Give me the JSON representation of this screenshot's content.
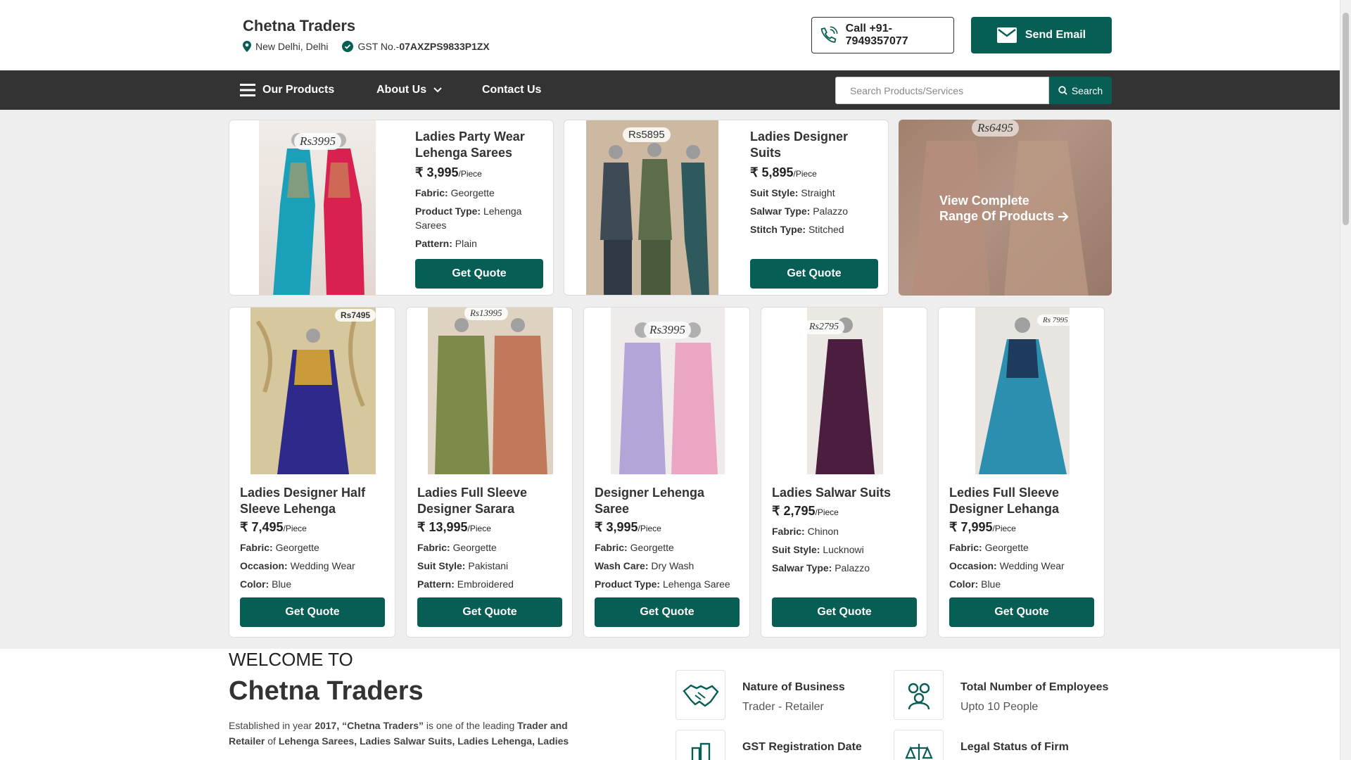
{
  "header": {
    "company_name": "Chetna Traders",
    "location": "New Delhi, Delhi",
    "gst_label": "GST No.-",
    "gst_number": "07AXZPS9833P1ZX",
    "call_label": "Call +91-7949357077",
    "email_label": "Send Email"
  },
  "nav": {
    "products": "Our Products",
    "about": "About Us",
    "contact": "Contact Us",
    "search_placeholder": "Search Products/Services",
    "search_button": "Search"
  },
  "featured": [
    {
      "name_line1": "Ladies Party Wear",
      "name_line2": "Lehenga Sarees",
      "price": "₹ 3,995",
      "unit": "/Piece",
      "tag": "Rs3995",
      "specs": [
        {
          "label": "Fabric:",
          "value": "Georgette"
        },
        {
          "label": "Product Type:",
          "value": "Lehenga"
        },
        {
          "label": "",
          "value": "Sarees"
        },
        {
          "label": "Pattern:",
          "value": "Plain"
        }
      ],
      "cta": "Get Quote"
    },
    {
      "name_line1": "Ladies Designer",
      "name_line2": "Suits",
      "price": "₹ 5,895",
      "unit": "/Piece",
      "tag": "Rs5895",
      "specs": [
        {
          "label": "Suit Style:",
          "value": "Straight"
        },
        {
          "label": "Salwar Type:",
          "value": "Palazzo"
        },
        {
          "label": "Stitch Type:",
          "value": "Stitched"
        }
      ],
      "cta": "Get Quote"
    }
  ],
  "view_all": {
    "line1": "View Complete",
    "line2": "Range Of Products",
    "tag": "Rs6495"
  },
  "products": [
    {
      "name_line1": "Ladies Designer Half",
      "name_line2": "Sleeve Lehenga",
      "price": "₹ 7,495",
      "unit": "/Piece",
      "tag": "Rs7495",
      "specs": [
        {
          "label": "Fabric:",
          "value": "Georgette"
        },
        {
          "label": "Occasion:",
          "value": "Wedding Wear"
        },
        {
          "label": "Color:",
          "value": "Blue"
        }
      ],
      "cta": "Get Quote"
    },
    {
      "name_line1": "Ladies Full Sleeve",
      "name_line2": "Designer Sarara",
      "price": "₹ 13,995",
      "unit": "/Piece",
      "tag": "Rs13995",
      "specs": [
        {
          "label": "Fabric:",
          "value": "Georgette"
        },
        {
          "label": "Suit Style:",
          "value": "Pakistani"
        },
        {
          "label": "Pattern:",
          "value": "Embroidered"
        }
      ],
      "cta": "Get Quote"
    },
    {
      "name_line1": "Designer Lehenga",
      "name_line2": "Saree",
      "price": "₹ 3,995",
      "unit": "/Piece",
      "tag": "Rs3995",
      "specs": [
        {
          "label": "Fabric:",
          "value": "Georgette"
        },
        {
          "label": "Wash Care:",
          "value": "Dry Wash"
        },
        {
          "label": "Product Type:",
          "value": "Lehenga Saree"
        }
      ],
      "cta": "Get Quote"
    },
    {
      "name_line1": "Ladies Salwar Suits",
      "name_line2": "",
      "price": "₹ 2,795",
      "unit": "/Piece",
      "tag": "Rs2795",
      "specs": [
        {
          "label": "Fabric:",
          "value": "Chinon"
        },
        {
          "label": "Suit Style:",
          "value": "Lucknowi"
        },
        {
          "label": "Salwar Type:",
          "value": "Palazzo"
        }
      ],
      "cta": "Get Quote"
    },
    {
      "name_line1": "Ledies Full Sleeve",
      "name_line2": "Designer Lehanga",
      "price": "₹ 7,995",
      "unit": "/Piece",
      "tag": "Rs 7995",
      "specs": [
        {
          "label": "Fabric:",
          "value": "Georgette"
        },
        {
          "label": "Occasion:",
          "value": "Wedding Wear"
        },
        {
          "label": "Color:",
          "value": "Blue"
        }
      ],
      "cta": "Get Quote"
    }
  ],
  "welcome": {
    "line1": "WELCOME TO",
    "line2": "Chetna Traders",
    "p_a": "Established in year ",
    "p_b": "2017, “Chetna Traders”",
    "p_c": " is one of the leading ",
    "p_d": "Trader and Retailer",
    "p_e": " of ",
    "p_f": "Lehenga Sarees, Ladies Salwar Suits, Ladies Lehenga, Ladies"
  },
  "facts": [
    {
      "title": "Nature of Business",
      "value": "Trader - Retailer",
      "icon": "handshake-icon"
    },
    {
      "title": "Total Number of Employees",
      "value": "Upto 10 People",
      "icon": "people-icon"
    },
    {
      "title": "GST Registration Date",
      "value": "",
      "icon": "building-icon"
    },
    {
      "title": "Legal Status of Firm",
      "value": "",
      "icon": "scales-icon"
    }
  ],
  "colors": {
    "brand_green": "#075e54",
    "nav_dark": "#333333",
    "bg_gray": "#eeeeee"
  }
}
